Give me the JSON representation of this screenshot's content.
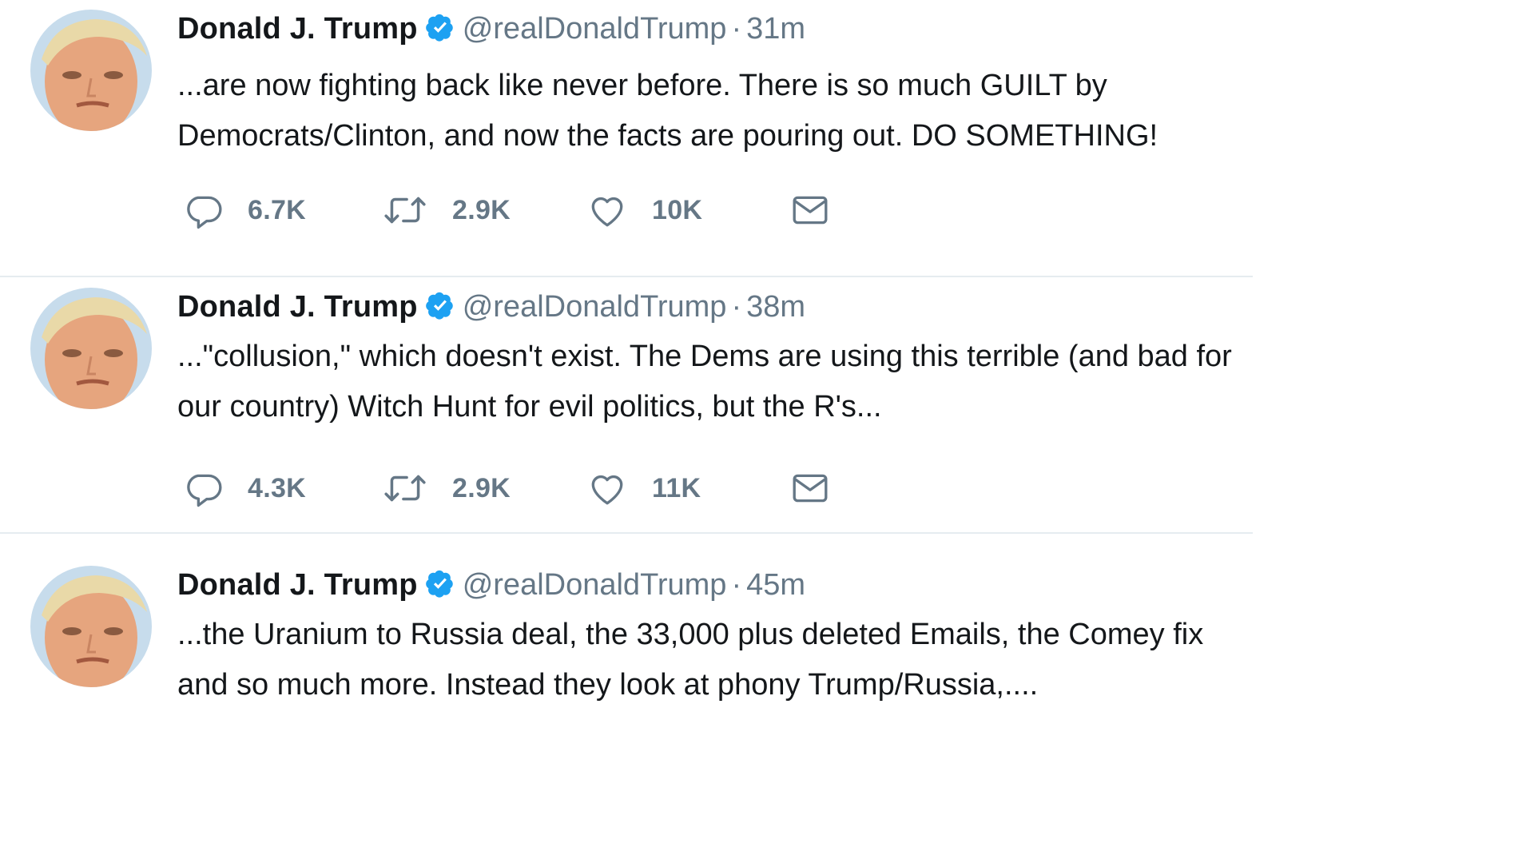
{
  "tweets": [
    {
      "name": "Donald J. Trump",
      "handle": "@realDonaldTrump",
      "separator": "·",
      "time": "31m",
      "text_lines": [
        "...are now fighting back like never before. There is so much GUILT by",
        "Democrats/Clinton, and now the facts are pouring out. DO SOMETHING!"
      ],
      "replies": "6.7K",
      "retweets": "2.9K",
      "likes": "10K",
      "icons": {
        "reply": "reply-icon",
        "retweet": "retweet-icon",
        "like": "heart-icon",
        "dm": "mail-icon",
        "verified": "verified-badge-icon"
      }
    },
    {
      "name": "Donald J. Trump",
      "handle": "@realDonaldTrump",
      "separator": "·",
      "time": "38m",
      "text_lines": [
        "...\"collusion,\" which doesn't exist. The Dems are using this terrible (and bad for",
        "our country) Witch Hunt for evil politics, but the R's..."
      ],
      "replies": "4.3K",
      "retweets": "2.9K",
      "likes": "11K",
      "icons": {
        "reply": "reply-icon",
        "retweet": "retweet-icon",
        "like": "heart-icon",
        "dm": "mail-icon",
        "verified": "verified-badge-icon"
      }
    },
    {
      "name": "Donald J. Trump",
      "handle": "@realDonaldTrump",
      "separator": "·",
      "time": "45m",
      "text_lines": [
        "...the Uranium to Russia deal, the  33,000 plus deleted Emails, the Comey fix",
        "and so much more. Instead they look at phony Trump/Russia,...."
      ],
      "icons": {
        "verified": "verified-badge-icon"
      }
    }
  ],
  "colors": {
    "text": "#14171a",
    "secondary": "#657786",
    "verified": "#1da1f2",
    "divider": "#e6ecf0"
  }
}
